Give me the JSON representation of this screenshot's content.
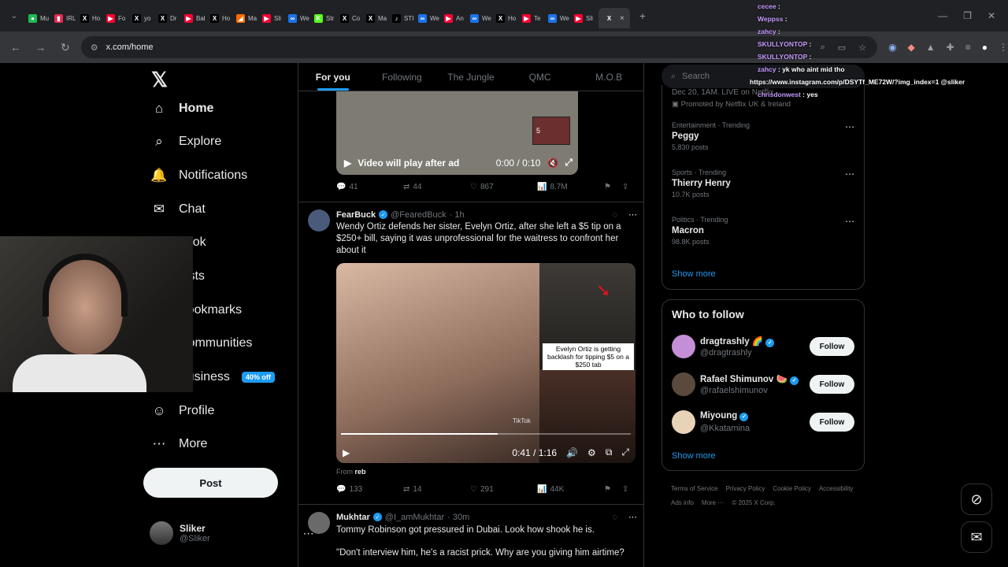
{
  "browser": {
    "tabs": [
      {
        "label": "Mu",
        "color": "#1db954",
        "glyph": "●"
      },
      {
        "label": "IRL",
        "color": "#e22a4e",
        "glyph": "▮"
      },
      {
        "label": "Ho",
        "color": "#000000",
        "glyph": "X"
      },
      {
        "label": "Fo",
        "color": "#ff0033",
        "glyph": "▶"
      },
      {
        "label": "yo",
        "color": "#000000",
        "glyph": "X"
      },
      {
        "label": "Dr",
        "color": "#000000",
        "glyph": "X"
      },
      {
        "label": "Bal",
        "color": "#ff0033",
        "glyph": "▶"
      },
      {
        "label": "Ho",
        "color": "#000000",
        "glyph": "X"
      },
      {
        "label": "Ma",
        "color": "#ff6a00",
        "glyph": "◢"
      },
      {
        "label": "Sli",
        "color": "#ff0033",
        "glyph": "▶"
      },
      {
        "label": "We",
        "color": "#1a73e8",
        "glyph": "∞"
      },
      {
        "label": "Str",
        "color": "#53fc18",
        "glyph": "K"
      },
      {
        "label": "Co",
        "color": "#000000",
        "glyph": "X"
      },
      {
        "label": "Ma",
        "color": "#000000",
        "glyph": "X"
      },
      {
        "label": "STI",
        "color": "#000000",
        "glyph": "♪"
      },
      {
        "label": "We",
        "color": "#1a73e8",
        "glyph": "∞"
      },
      {
        "label": "An",
        "color": "#ff0033",
        "glyph": "▶"
      },
      {
        "label": "We",
        "color": "#1a73e8",
        "glyph": "∞"
      },
      {
        "label": "Ho",
        "color": "#000000",
        "glyph": "X"
      },
      {
        "label": "Te",
        "color": "#ff0033",
        "glyph": "▶"
      },
      {
        "label": "We",
        "color": "#1a73e8",
        "glyph": "∞"
      },
      {
        "label": "Sli",
        "color": "#ff0033",
        "glyph": "▶"
      }
    ],
    "url": "x.com/home"
  },
  "nav": {
    "items": [
      {
        "label": "Home",
        "icon": "⌂"
      },
      {
        "label": "Explore",
        "icon": "⌕"
      },
      {
        "label": "Notifications",
        "icon": "🔔"
      },
      {
        "label": "Chat",
        "icon": "✉"
      },
      {
        "label": "Grok",
        "icon": "◪"
      },
      {
        "label": "Lists",
        "icon": "☰"
      },
      {
        "label": "Bookmarks",
        "icon": "⚑"
      },
      {
        "label": "Communities",
        "icon": "⚇"
      },
      {
        "label": "Business",
        "icon": "ϟ",
        "badge": "40% off"
      },
      {
        "label": "Profile",
        "icon": "☺"
      },
      {
        "label": "More",
        "icon": "⋯"
      }
    ],
    "post_label": "Post",
    "user_name": "Sliker",
    "user_handle": "@Sliker"
  },
  "feed": {
    "tabs": [
      "For you",
      "Following",
      "The Jungle",
      "QMC",
      "M.O.B"
    ],
    "tweet1": {
      "overlay": "Video will play after ad",
      "time": "0:00 / 0:10",
      "ad_count": "5",
      "replies": "41",
      "retweets": "44",
      "likes": "867",
      "views": "8.7M"
    },
    "tweet2": {
      "name": "FearBuck",
      "handle": "@FearedBuck",
      "time": "· 1h",
      "text": "Wendy Ortiz defends her sister, Evelyn Ortiz, after she left a $5 tip on a $250+ bill, saying it was unprofessional for the waitress to confront her about it",
      "caption": "Evelyn Ortiz is getting backlash for tipping $5 on a $250 tab",
      "video_time": "0:41 / 1:16",
      "from_label": "From",
      "from_user": "reb",
      "watermark": "TikTok",
      "replies": "133",
      "retweets": "14",
      "likes": "291",
      "views": "44K"
    },
    "tweet3": {
      "name": "Mukhtar",
      "handle": "@I_amMukhtar",
      "time": "· 30m",
      "text": "Tommy Robinson got pressured in Dubai. Look how shook he is.",
      "text2": "\"Don't interview him, he's a racist prick. Why are you giving him airtime?"
    }
  },
  "sidebar": {
    "search_placeholder": "Search",
    "promo_line": "Dec 20, 1AM. LIVE on Netflix",
    "promo_by": "Promoted by Netflix UK & Ireland",
    "trends": [
      {
        "category": "Entertainment · Trending",
        "name": "Peggy",
        "posts": "5,830 posts"
      },
      {
        "category": "Sports · Trending",
        "name": "Thierry Henry",
        "posts": "10.7K posts"
      },
      {
        "category": "Politics · Trending",
        "name": "Macron",
        "posts": "98.8K posts"
      }
    ],
    "show_more": "Show more",
    "who_to_follow_title": "Who to follow",
    "follow_suggestions": [
      {
        "name": "dragtrashly",
        "handle": "@dragtrashly",
        "emoji": "🌈"
      },
      {
        "name": "Rafael Shimunov",
        "handle": "@rafaelshimunov",
        "emoji": "🍉"
      },
      {
        "name": "Miyoung",
        "handle": "@Kkatamina",
        "emoji": ""
      }
    ],
    "follow_label": "Follow",
    "footer": [
      "Terms of Service",
      "Privacy Policy",
      "Cookie Policy",
      "Accessibility",
      "Ads info",
      "More ···",
      "© 2025 X Corp."
    ]
  },
  "chat": [
    {
      "user": "cecee",
      "msg": ""
    },
    {
      "user": "Weppss",
      "msg": ""
    },
    {
      "user": "zahcy",
      "msg": ""
    },
    {
      "user": "SKULLYONTOP",
      "msg": ""
    },
    {
      "user": "SKULLYONTOP",
      "msg": ""
    },
    {
      "user": "zahcy",
      "msg": "yk who aint mid tho"
    },
    {
      "user": "",
      "msg": "https://www.instagram.com/p/DSYTf_ME72W/?img_index=1 @sliker"
    },
    {
      "user": "chrisdonwest",
      "msg": "yes"
    }
  ]
}
